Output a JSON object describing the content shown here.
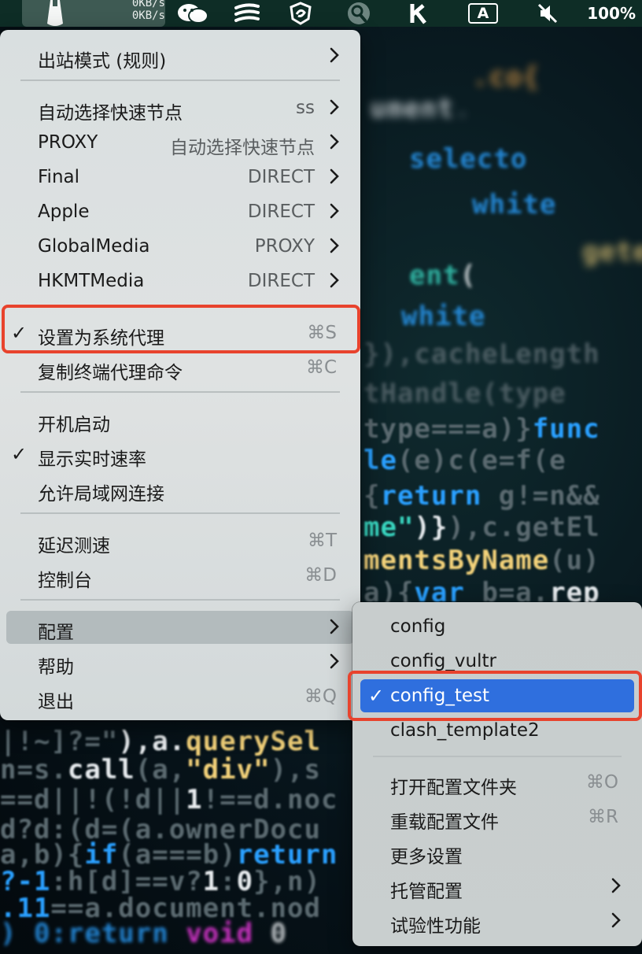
{
  "menubar": {
    "netspeed_up": "0KB/s",
    "netspeed_down": "0KB/s",
    "input_source": "A",
    "battery": "100%",
    "icons": [
      "clash-app-icon",
      "wechat-icon",
      "menu-lines-icon",
      "shield-swirl-icon",
      "search-circle-icon",
      "kindle-k-icon",
      "input-source-icon",
      "mute-icon"
    ]
  },
  "main_menu": {
    "outbound_mode": "出站模式 (规则)",
    "proxy_groups": [
      {
        "name": "自动选择快速节点",
        "value": "ss"
      },
      {
        "name": "PROXY",
        "value": "自动选择快速节点"
      },
      {
        "name": "Final",
        "value": "DIRECT"
      },
      {
        "name": "Apple",
        "value": "DIRECT"
      },
      {
        "name": "GlobalMedia",
        "value": "PROXY"
      },
      {
        "name": "HKMTMedia",
        "value": "DIRECT"
      }
    ],
    "set_system_proxy": {
      "label": "设置为系统代理",
      "shortcut": "⌘S",
      "checked": true
    },
    "copy_terminal_cmd": {
      "label": "复制终端代理命令",
      "shortcut": "⌘C"
    },
    "launch_at_login": {
      "label": "开机启动"
    },
    "show_speed": {
      "label": "显示实时速率",
      "checked": true
    },
    "allow_lan": {
      "label": "允许局域网连接"
    },
    "latency_test": {
      "label": "延迟测速",
      "shortcut": "⌘T"
    },
    "dashboard": {
      "label": "控制台",
      "shortcut": "⌘D"
    },
    "config": {
      "label": "配置"
    },
    "help": {
      "label": "帮助"
    },
    "quit": {
      "label": "退出",
      "shortcut": "⌘Q"
    }
  },
  "config_submenu": {
    "configs": [
      "config",
      "config_vultr",
      "config_test",
      "clash_template2"
    ],
    "selected": "config_test",
    "open_folder": {
      "label": "打开配置文件夹",
      "shortcut": "⌘O"
    },
    "reload": {
      "label": "重载配置文件",
      "shortcut": "⌘R"
    },
    "more_settings": {
      "label": "更多设置"
    },
    "managed_config": {
      "label": "托管配置"
    },
    "experimental": {
      "label": "试验性功能"
    }
  },
  "check_mark": "✓",
  "colors": {
    "highlight": "#2f6fde",
    "annotation": "#e8432d",
    "menubar": "#0e2d26"
  }
}
